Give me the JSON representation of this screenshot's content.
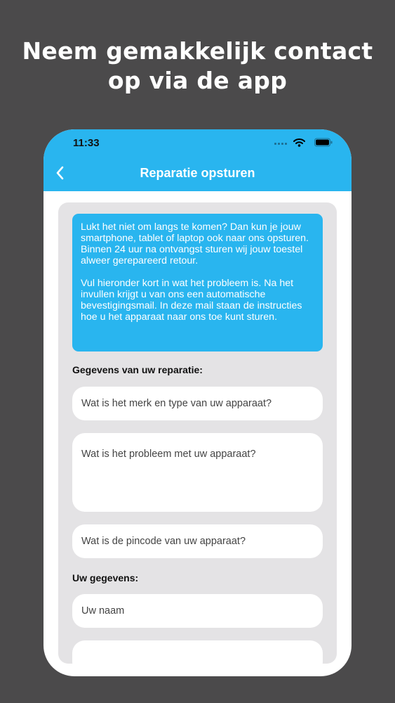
{
  "headline": {
    "line1": "Neem gemakkelijk contact",
    "line2": "op via de app"
  },
  "status_bar": {
    "time": "11:33"
  },
  "nav": {
    "title": "Reparatie opsturen"
  },
  "info": {
    "paragraph1": "Lukt het niet om langs te komen? Dan kun je jouw smartphone, tablet of laptop ook naar ons opsturen. Binnen 24 uur na ontvangst sturen wij jouw toestel alweer gerepareerd retour.",
    "paragraph2": "Vul hieronder kort in wat het probleem is. Na het invullen krijgt u van ons een automatische bevestigingsmail. In deze mail staan de instructies hoe u het apparaat naar ons toe kunt sturen."
  },
  "repair_section": {
    "label": "Gegevens van uw reparatie:",
    "brand_placeholder": "Wat is het merk en type van uw apparaat?",
    "problem_placeholder": "Wat is het probleem met uw apparaat?",
    "pincode_placeholder": "Wat is de pincode van uw apparaat?"
  },
  "personal_section": {
    "label": "Uw gegevens:",
    "name_placeholder": "Uw naam",
    "next_placeholder": ""
  },
  "colors": {
    "accent": "#29b5ef",
    "background": "#4b4a4b",
    "panel": "#e4e3e5"
  },
  "icons": [
    "back-chevron-icon",
    "signal-icon",
    "wifi-icon",
    "battery-icon"
  ]
}
